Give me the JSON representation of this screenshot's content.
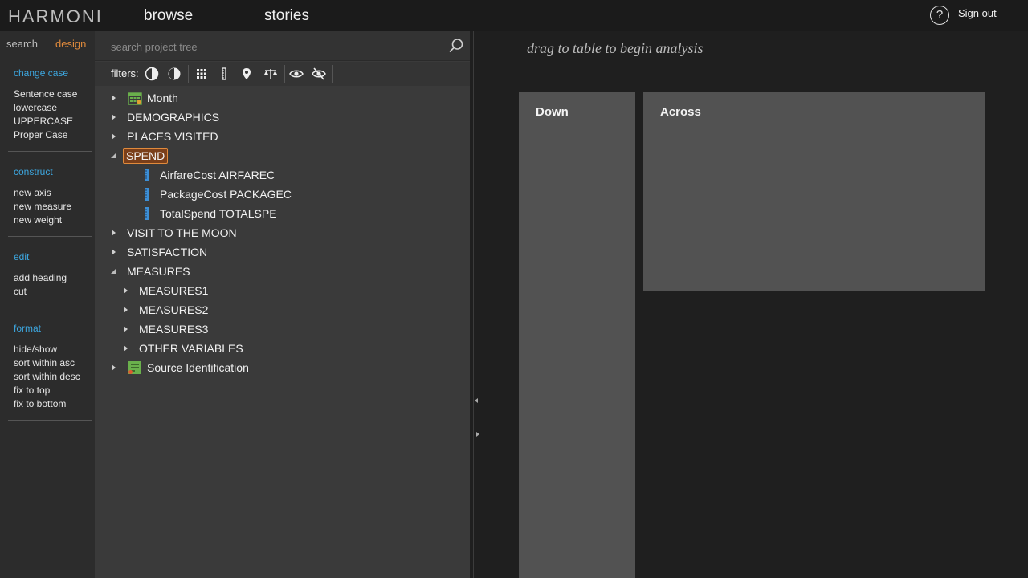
{
  "app": {
    "logo": "HARMONI"
  },
  "nav": {
    "browse": "browse",
    "stories": "stories",
    "help": "?",
    "signout": "Sign out"
  },
  "left_tabs": {
    "search": "search",
    "design": "design"
  },
  "left_menu": [
    {
      "head": "change case",
      "items": [
        "Sentence case",
        "lowercase",
        "UPPERCASE",
        "Proper Case"
      ]
    },
    {
      "head": "construct",
      "items": [
        "new axis",
        "new measure",
        "new weight"
      ]
    },
    {
      "head": "edit",
      "items": [
        "add heading",
        "cut"
      ]
    },
    {
      "head": "format",
      "items": [
        "hide/show",
        "sort within asc",
        "sort within desc",
        "fix to top",
        "fix to bottom"
      ]
    }
  ],
  "search": {
    "placeholder": "search project tree"
  },
  "filters": {
    "label": "filters:"
  },
  "tree": [
    {
      "label": "Month",
      "state": "closed",
      "icon": "calendar-icon",
      "depth": 0
    },
    {
      "label": "DEMOGRAPHICS",
      "state": "closed",
      "depth": 0
    },
    {
      "label": "PLACES VISITED",
      "state": "closed",
      "depth": 0
    },
    {
      "label": "SPEND",
      "state": "open",
      "selected": true,
      "depth": 0
    },
    {
      "label": "AirfareCost AIRFAREC",
      "icon": "ruler-icon",
      "depth": 1
    },
    {
      "label": "PackageCost PACKAGEC",
      "icon": "ruler-icon",
      "depth": 1
    },
    {
      "label": "TotalSpend TOTALSPE",
      "icon": "ruler-icon",
      "depth": 1
    },
    {
      "label": "VISIT TO THE MOON",
      "state": "closed",
      "depth": 0
    },
    {
      "label": "SATISFACTION",
      "state": "closed",
      "depth": 0
    },
    {
      "label": "MEASURES",
      "state": "open",
      "depth": 0
    },
    {
      "label": "MEASURES1",
      "state": "closed",
      "depth": 1
    },
    {
      "label": "MEASURES2",
      "state": "closed",
      "depth": 1
    },
    {
      "label": "MEASURES3",
      "state": "closed",
      "depth": 1
    },
    {
      "label": "OTHER VARIABLES",
      "state": "closed",
      "depth": 1
    },
    {
      "label": "Source Identification",
      "state": "closed",
      "icon": "source-icon",
      "depth": 0
    }
  ],
  "main": {
    "hint": "drag to table to begin analysis",
    "down": "Down",
    "across": "Across"
  },
  "colors": {
    "accent_blue": "#3da7e0",
    "accent_orange": "#e08a3c",
    "selected_bg": "#7a3f1a"
  }
}
